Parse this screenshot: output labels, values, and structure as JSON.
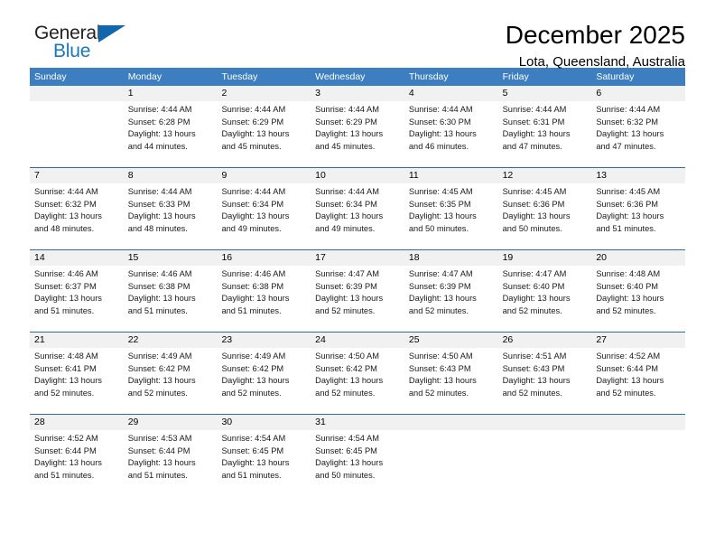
{
  "brand": {
    "name_part1": "General",
    "name_part2": "Blue",
    "accent_color": "#1878be",
    "triangle_color": "#1266ab"
  },
  "header": {
    "title": "December 2025",
    "subtitle": "Lota, Queensland, Australia"
  },
  "theme": {
    "header_row_bg": "#3c7ebf",
    "header_row_text": "#ffffff",
    "day_band_bg": "#f1f1f1",
    "week_divider": "#2f6ca8"
  },
  "weekday_headers": [
    "Sunday",
    "Monday",
    "Tuesday",
    "Wednesday",
    "Thursday",
    "Friday",
    "Saturday"
  ],
  "weeks": [
    {
      "days": [
        {
          "num": "",
          "sunrise": "",
          "sunset": "",
          "daylight": "",
          "daylight2": ""
        },
        {
          "num": "1",
          "sunrise": "Sunrise: 4:44 AM",
          "sunset": "Sunset: 6:28 PM",
          "daylight": "Daylight: 13 hours",
          "daylight2": "and 44 minutes."
        },
        {
          "num": "2",
          "sunrise": "Sunrise: 4:44 AM",
          "sunset": "Sunset: 6:29 PM",
          "daylight": "Daylight: 13 hours",
          "daylight2": "and 45 minutes."
        },
        {
          "num": "3",
          "sunrise": "Sunrise: 4:44 AM",
          "sunset": "Sunset: 6:29 PM",
          "daylight": "Daylight: 13 hours",
          "daylight2": "and 45 minutes."
        },
        {
          "num": "4",
          "sunrise": "Sunrise: 4:44 AM",
          "sunset": "Sunset: 6:30 PM",
          "daylight": "Daylight: 13 hours",
          "daylight2": "and 46 minutes."
        },
        {
          "num": "5",
          "sunrise": "Sunrise: 4:44 AM",
          "sunset": "Sunset: 6:31 PM",
          "daylight": "Daylight: 13 hours",
          "daylight2": "and 47 minutes."
        },
        {
          "num": "6",
          "sunrise": "Sunrise: 4:44 AM",
          "sunset": "Sunset: 6:32 PM",
          "daylight": "Daylight: 13 hours",
          "daylight2": "and 47 minutes."
        }
      ]
    },
    {
      "days": [
        {
          "num": "7",
          "sunrise": "Sunrise: 4:44 AM",
          "sunset": "Sunset: 6:32 PM",
          "daylight": "Daylight: 13 hours",
          "daylight2": "and 48 minutes."
        },
        {
          "num": "8",
          "sunrise": "Sunrise: 4:44 AM",
          "sunset": "Sunset: 6:33 PM",
          "daylight": "Daylight: 13 hours",
          "daylight2": "and 48 minutes."
        },
        {
          "num": "9",
          "sunrise": "Sunrise: 4:44 AM",
          "sunset": "Sunset: 6:34 PM",
          "daylight": "Daylight: 13 hours",
          "daylight2": "and 49 minutes."
        },
        {
          "num": "10",
          "sunrise": "Sunrise: 4:44 AM",
          "sunset": "Sunset: 6:34 PM",
          "daylight": "Daylight: 13 hours",
          "daylight2": "and 49 minutes."
        },
        {
          "num": "11",
          "sunrise": "Sunrise: 4:45 AM",
          "sunset": "Sunset: 6:35 PM",
          "daylight": "Daylight: 13 hours",
          "daylight2": "and 50 minutes."
        },
        {
          "num": "12",
          "sunrise": "Sunrise: 4:45 AM",
          "sunset": "Sunset: 6:36 PM",
          "daylight": "Daylight: 13 hours",
          "daylight2": "and 50 minutes."
        },
        {
          "num": "13",
          "sunrise": "Sunrise: 4:45 AM",
          "sunset": "Sunset: 6:36 PM",
          "daylight": "Daylight: 13 hours",
          "daylight2": "and 51 minutes."
        }
      ]
    },
    {
      "days": [
        {
          "num": "14",
          "sunrise": "Sunrise: 4:46 AM",
          "sunset": "Sunset: 6:37 PM",
          "daylight": "Daylight: 13 hours",
          "daylight2": "and 51 minutes."
        },
        {
          "num": "15",
          "sunrise": "Sunrise: 4:46 AM",
          "sunset": "Sunset: 6:38 PM",
          "daylight": "Daylight: 13 hours",
          "daylight2": "and 51 minutes."
        },
        {
          "num": "16",
          "sunrise": "Sunrise: 4:46 AM",
          "sunset": "Sunset: 6:38 PM",
          "daylight": "Daylight: 13 hours",
          "daylight2": "and 51 minutes."
        },
        {
          "num": "17",
          "sunrise": "Sunrise: 4:47 AM",
          "sunset": "Sunset: 6:39 PM",
          "daylight": "Daylight: 13 hours",
          "daylight2": "and 52 minutes."
        },
        {
          "num": "18",
          "sunrise": "Sunrise: 4:47 AM",
          "sunset": "Sunset: 6:39 PM",
          "daylight": "Daylight: 13 hours",
          "daylight2": "and 52 minutes."
        },
        {
          "num": "19",
          "sunrise": "Sunrise: 4:47 AM",
          "sunset": "Sunset: 6:40 PM",
          "daylight": "Daylight: 13 hours",
          "daylight2": "and 52 minutes."
        },
        {
          "num": "20",
          "sunrise": "Sunrise: 4:48 AM",
          "sunset": "Sunset: 6:40 PM",
          "daylight": "Daylight: 13 hours",
          "daylight2": "and 52 minutes."
        }
      ]
    },
    {
      "days": [
        {
          "num": "21",
          "sunrise": "Sunrise: 4:48 AM",
          "sunset": "Sunset: 6:41 PM",
          "daylight": "Daylight: 13 hours",
          "daylight2": "and 52 minutes."
        },
        {
          "num": "22",
          "sunrise": "Sunrise: 4:49 AM",
          "sunset": "Sunset: 6:42 PM",
          "daylight": "Daylight: 13 hours",
          "daylight2": "and 52 minutes."
        },
        {
          "num": "23",
          "sunrise": "Sunrise: 4:49 AM",
          "sunset": "Sunset: 6:42 PM",
          "daylight": "Daylight: 13 hours",
          "daylight2": "and 52 minutes."
        },
        {
          "num": "24",
          "sunrise": "Sunrise: 4:50 AM",
          "sunset": "Sunset: 6:42 PM",
          "daylight": "Daylight: 13 hours",
          "daylight2": "and 52 minutes."
        },
        {
          "num": "25",
          "sunrise": "Sunrise: 4:50 AM",
          "sunset": "Sunset: 6:43 PM",
          "daylight": "Daylight: 13 hours",
          "daylight2": "and 52 minutes."
        },
        {
          "num": "26",
          "sunrise": "Sunrise: 4:51 AM",
          "sunset": "Sunset: 6:43 PM",
          "daylight": "Daylight: 13 hours",
          "daylight2": "and 52 minutes."
        },
        {
          "num": "27",
          "sunrise": "Sunrise: 4:52 AM",
          "sunset": "Sunset: 6:44 PM",
          "daylight": "Daylight: 13 hours",
          "daylight2": "and 52 minutes."
        }
      ]
    },
    {
      "days": [
        {
          "num": "28",
          "sunrise": "Sunrise: 4:52 AM",
          "sunset": "Sunset: 6:44 PM",
          "daylight": "Daylight: 13 hours",
          "daylight2": "and 51 minutes."
        },
        {
          "num": "29",
          "sunrise": "Sunrise: 4:53 AM",
          "sunset": "Sunset: 6:44 PM",
          "daylight": "Daylight: 13 hours",
          "daylight2": "and 51 minutes."
        },
        {
          "num": "30",
          "sunrise": "Sunrise: 4:54 AM",
          "sunset": "Sunset: 6:45 PM",
          "daylight": "Daylight: 13 hours",
          "daylight2": "and 51 minutes."
        },
        {
          "num": "31",
          "sunrise": "Sunrise: 4:54 AM",
          "sunset": "Sunset: 6:45 PM",
          "daylight": "Daylight: 13 hours",
          "daylight2": "and 50 minutes."
        },
        {
          "num": "",
          "sunrise": "",
          "sunset": "",
          "daylight": "",
          "daylight2": ""
        },
        {
          "num": "",
          "sunrise": "",
          "sunset": "",
          "daylight": "",
          "daylight2": ""
        },
        {
          "num": "",
          "sunrise": "",
          "sunset": "",
          "daylight": "",
          "daylight2": ""
        }
      ]
    }
  ]
}
